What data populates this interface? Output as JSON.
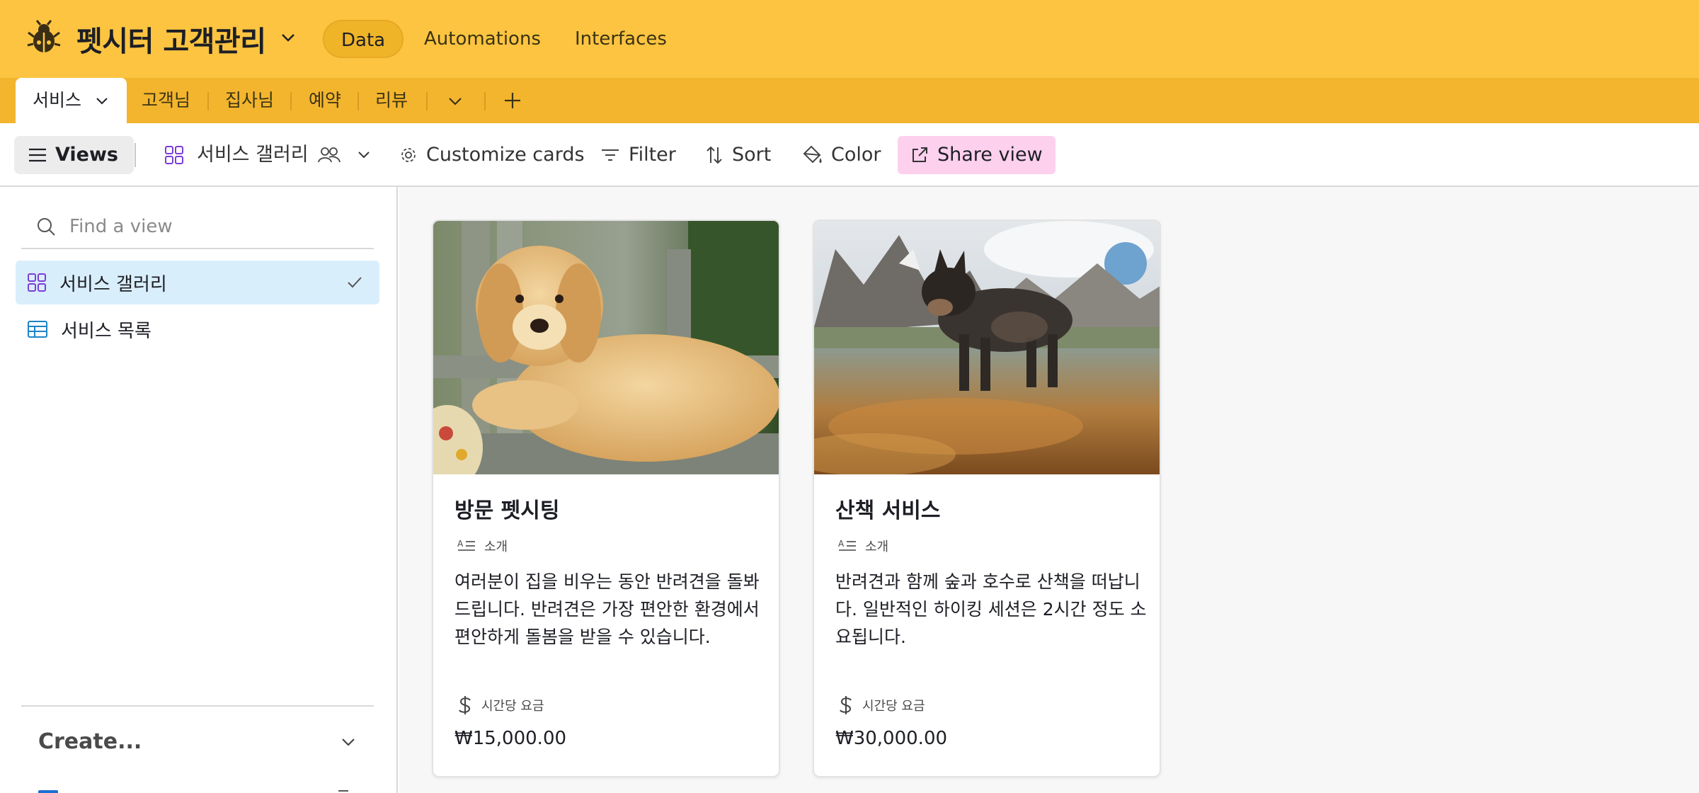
{
  "app": {
    "base_name": "펫시터 고객관리",
    "nav": [
      "Data",
      "Automations",
      "Interfaces"
    ],
    "brand_color": "#fcc440"
  },
  "tables": {
    "active": "서비스",
    "others": [
      "고객님",
      "집사님",
      "예약",
      "리뷰"
    ]
  },
  "toolbar": {
    "views_label": "Views",
    "current_view": "서비스 갤러리",
    "customize_label": "Customize cards",
    "filter_label": "Filter",
    "sort_label": "Sort",
    "color_label": "Color",
    "share_label": "Share view"
  },
  "sidebar": {
    "search_placeholder": "Find a view",
    "views": [
      {
        "label": "서비스 갤러리",
        "icon": "gallery-icon",
        "selected": true
      },
      {
        "label": "서비스 목록",
        "icon": "grid-icon",
        "selected": false
      }
    ],
    "create_label": "Create..."
  },
  "cards": [
    {
      "title": "방문 펫시팅",
      "intro_label": "소개",
      "description": "여러분이 집을 비우는 동안 반려견을 돌봐드립니다. 반려견은 가장 편안한 환경에서 편안하게 돌봄을 받을 수 있습니다.",
      "price_label": "시간당 요금",
      "price": "₩15,000.00"
    },
    {
      "title": "산책 서비스",
      "intro_label": "소개",
      "description": "반려견과 함께 숲과 호수로 산책을 떠납니다. 일반적인 하이킹 세션은 2시간 정도 소요됩니다.",
      "price_label": "시간당 요금",
      "price": "₩30,000.00"
    }
  ]
}
